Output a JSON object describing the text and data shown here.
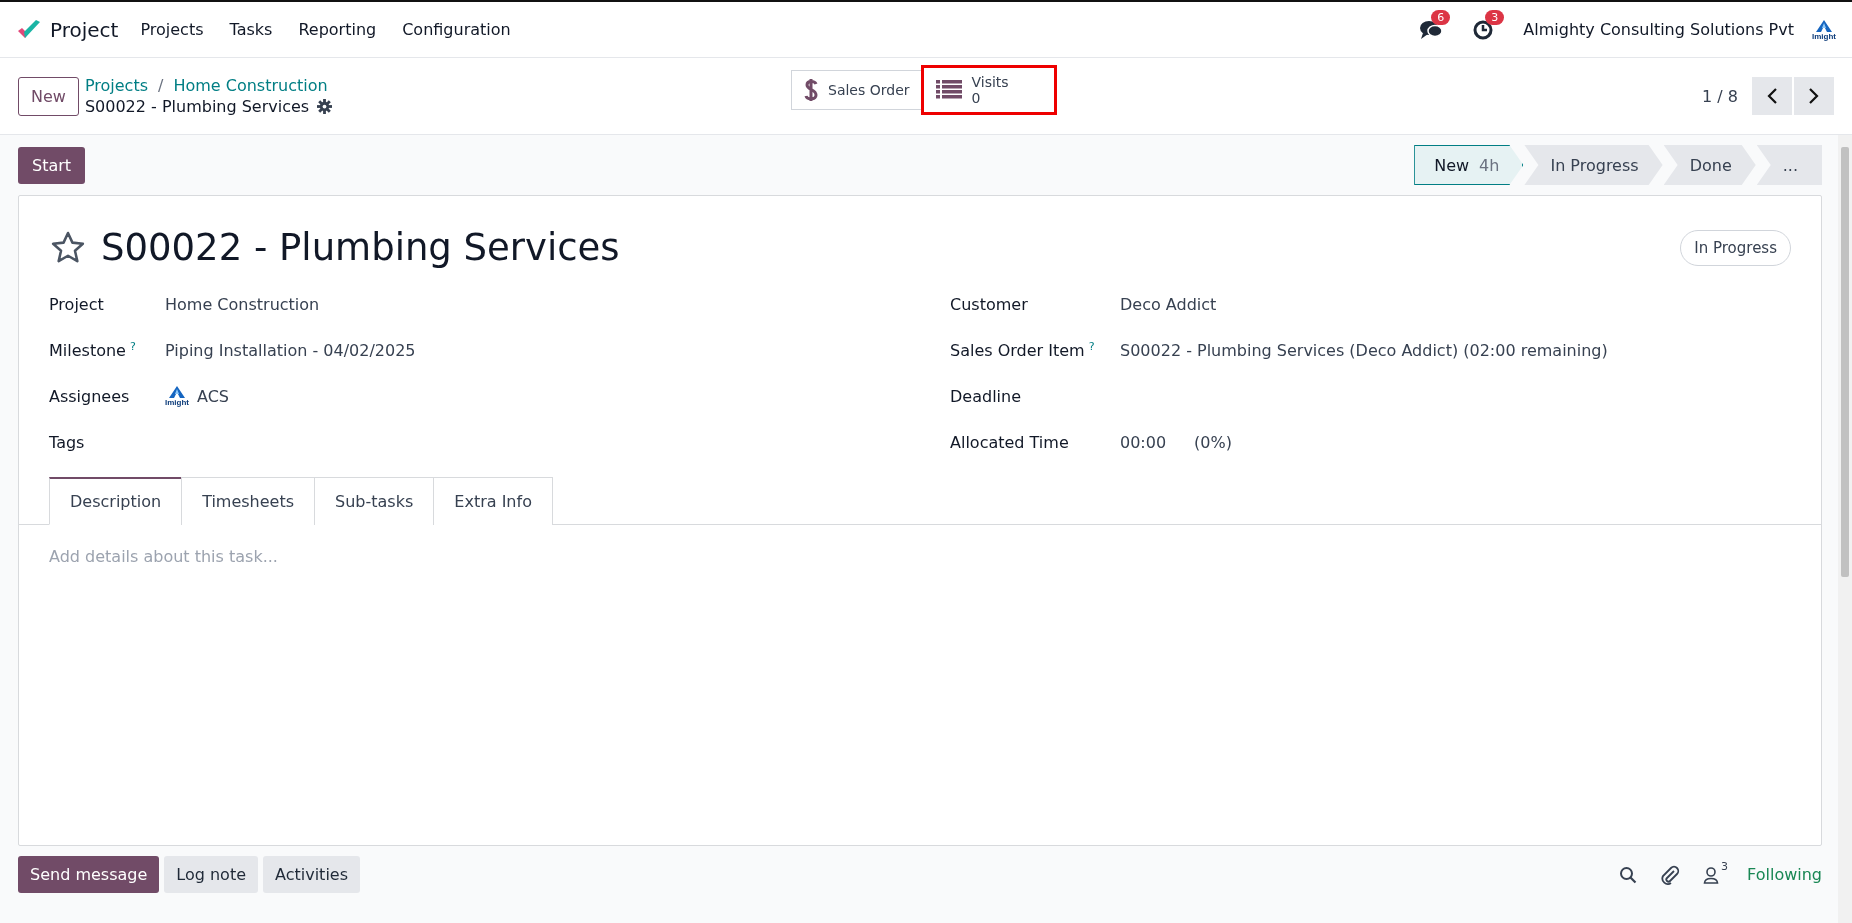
{
  "navbar": {
    "app_name": "Project",
    "menu": [
      "Projects",
      "Tasks",
      "Reporting",
      "Configuration"
    ],
    "messages_count": "6",
    "activities_count": "3",
    "company": "Almighty Consulting Solutions Pvt",
    "company_logo_text": "Imight"
  },
  "control_panel": {
    "new_button": "New",
    "breadcrumbs": [
      "Projects",
      "Home Construction"
    ],
    "breadcrumb_separator": "/",
    "record_name": "S00022 - Plumbing Services",
    "smart_buttons": [
      {
        "kind": "sales_order",
        "label": "Sales Order",
        "highlighted": false
      },
      {
        "kind": "visits",
        "label": "Visits",
        "value": "0",
        "highlighted": true
      }
    ],
    "pager": "1 / 8"
  },
  "status_row": {
    "start_button": "Start",
    "stages": [
      {
        "label": "New",
        "duration": "4h",
        "selected": true
      },
      {
        "label": "In Progress",
        "selected": false
      },
      {
        "label": "Done",
        "selected": false
      },
      {
        "label": "...",
        "selected": false
      }
    ]
  },
  "form": {
    "starred": false,
    "title": "S00022 - Plumbing Services",
    "state_badge": "In Progress",
    "left_fields": [
      {
        "label": "Project",
        "value": "Home Construction"
      },
      {
        "label": "Milestone",
        "help": "?",
        "value": "Piping Installation - 04/02/2025"
      },
      {
        "label": "Assignees",
        "kind": "avatar",
        "avatar_text": "Imight",
        "value": "ACS"
      },
      {
        "label": "Tags"
      }
    ],
    "right_fields": [
      {
        "label": "Customer",
        "value": "Deco Addict"
      },
      {
        "label": "Sales Order Item",
        "help": "?",
        "value": "S00022 - Plumbing Services (Deco Addict) (02:00 remaining)"
      },
      {
        "label": "Deadline"
      },
      {
        "label": "Allocated Time",
        "value": "00:00",
        "extra": "(0%)"
      }
    ],
    "tabs": [
      {
        "label": "Description",
        "selected": true
      },
      {
        "label": "Timesheets",
        "selected": false
      },
      {
        "label": "Sub-tasks",
        "selected": false
      },
      {
        "label": "Extra Info",
        "selected": false
      }
    ],
    "description_placeholder": "Add details about this task..."
  },
  "chatter": {
    "buttons": [
      {
        "label": "Send message",
        "primary": true
      },
      {
        "label": "Log note",
        "primary": false
      },
      {
        "label": "Activities",
        "primary": false
      }
    ],
    "followers_count": "3",
    "follow_status": "Following"
  }
}
